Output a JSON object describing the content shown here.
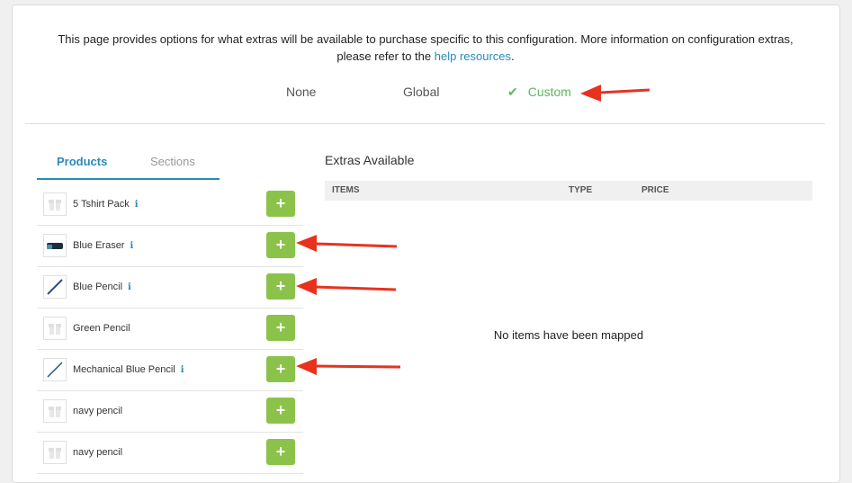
{
  "intro": {
    "text": "This page provides options for what extras will be available to purchase specific to this configuration. More information on configuration extras,",
    "text2": "please refer to the ",
    "link": "help resources",
    "text3": "."
  },
  "modes": {
    "none": "None",
    "global": "Global",
    "custom": "Custom"
  },
  "tabs": {
    "products": "Products",
    "sections": "Sections"
  },
  "products": [
    {
      "name": "5 Tshirt Pack",
      "info": "i",
      "add": "+"
    },
    {
      "name": "Blue Eraser",
      "info": "i",
      "add": "+"
    },
    {
      "name": "Blue Pencil",
      "info": "i",
      "add": "+"
    },
    {
      "name": "Green Pencil",
      "add": "+"
    },
    {
      "name": "Mechanical Blue Pencil",
      "info": "i",
      "add": "+"
    },
    {
      "name": "navy pencil",
      "add": "+"
    },
    {
      "name": "navy pencil",
      "add": "+"
    }
  ],
  "extras": {
    "title": "Extras Available",
    "columns": {
      "items": "ITEMS",
      "type": "TYPE",
      "price": "PRICE"
    },
    "empty": "No items have been mapped"
  },
  "colors": {
    "accent": "#2a8ab8",
    "success": "#5cb85c",
    "add_button": "#8bc34a",
    "annotation_arrow": "#e8321e"
  }
}
